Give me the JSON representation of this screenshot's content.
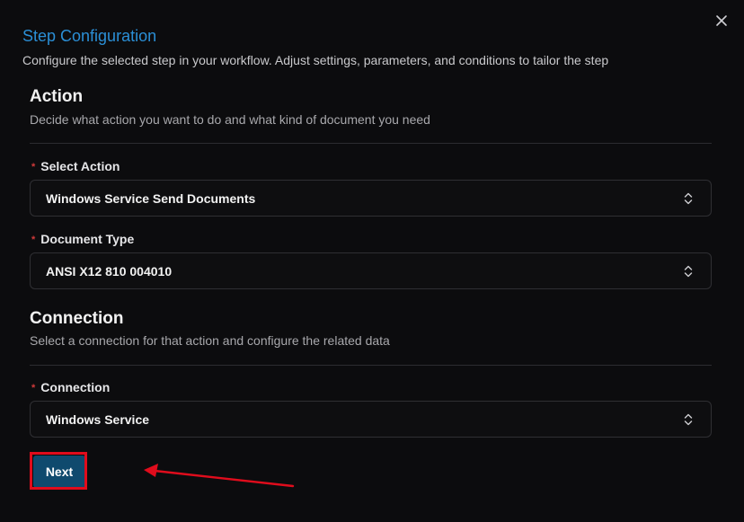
{
  "dialog": {
    "title": "Step Configuration",
    "subtitle": "Configure the selected step in your workflow. Adjust settings, parameters, and conditions to tailor the step",
    "close_icon": "close-icon"
  },
  "action_section": {
    "title": "Action",
    "description": "Decide what action you want to do and what kind of document you need",
    "fields": [
      {
        "label": "Select Action",
        "required_mark": "*",
        "value": "Windows Service Send Documents"
      },
      {
        "label": "Document Type",
        "required_mark": "*",
        "value": "ANSI X12 810 004010"
      }
    ]
  },
  "connection_section": {
    "title": "Connection",
    "description": "Select a connection for that action and configure the related data",
    "fields": [
      {
        "label": "Connection",
        "required_mark": "*",
        "value": "Windows Service"
      }
    ]
  },
  "footer": {
    "next_label": "Next"
  },
  "colors": {
    "title_blue": "#2b8fd6",
    "button_bg": "#0f4a6e",
    "annotation_red": "#e00c1c",
    "required_red": "#d03a3a"
  }
}
